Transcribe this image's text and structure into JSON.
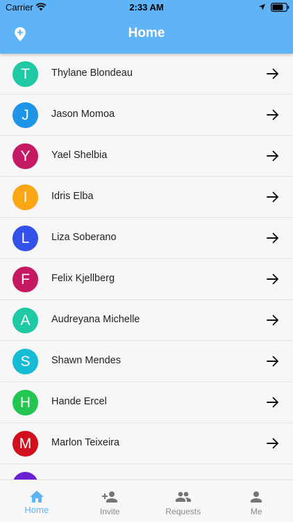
{
  "status_bar": {
    "carrier": "Carrier",
    "time": "2:33 AM"
  },
  "app_bar": {
    "title": "Home",
    "left_icon": "add-location-icon"
  },
  "colors": {
    "header": "#5fb4f8",
    "active_tab": "#5fb4f8",
    "inactive_tab": "#8a8a8a"
  },
  "contacts": [
    {
      "initial": "T",
      "name": "Thylane Blondeau",
      "color": "#1ec9a4"
    },
    {
      "initial": "J",
      "name": "Jason Momoa",
      "color": "#1f95e8"
    },
    {
      "initial": "Y",
      "name": "Yael Shelbia",
      "color": "#c51a63"
    },
    {
      "initial": "I",
      "name": "Idris Elba",
      "color": "#fba614"
    },
    {
      "initial": "L",
      "name": "Liza Soberano",
      "color": "#3350e8"
    },
    {
      "initial": "F",
      "name": "Felix Kjellberg",
      "color": "#c51a63"
    },
    {
      "initial": "A",
      "name": "Audreyana Michelle",
      "color": "#1ec9a4"
    },
    {
      "initial": "S",
      "name": "Shawn Mendes",
      "color": "#16bcd6"
    },
    {
      "initial": "H",
      "name": "Hande Ercel",
      "color": "#22c651"
    },
    {
      "initial": "M",
      "name": "Marlon Teixeira",
      "color": "#d0101d"
    },
    {
      "initial": "",
      "name": "",
      "color": "#6a1fd0"
    }
  ],
  "tabs": [
    {
      "label": "Home",
      "icon": "home-icon",
      "active": true
    },
    {
      "label": "Invite",
      "icon": "person-add-icon",
      "active": false
    },
    {
      "label": "Requests",
      "icon": "people-icon",
      "active": false
    },
    {
      "label": "Me",
      "icon": "person-icon",
      "active": false
    }
  ]
}
